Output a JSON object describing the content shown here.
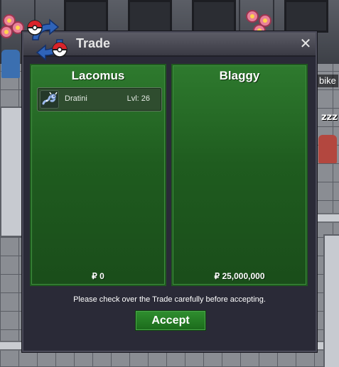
{
  "window": {
    "title": "Trade",
    "close_symbol": "✕",
    "close_icon": "close-icon",
    "logo_icon": "trade-arrows-icon"
  },
  "left_trader": {
    "name": "Lacomus",
    "offer": [
      {
        "pokemon": "Dratini",
        "level": "Lvl: 26",
        "icon": "dratini-icon"
      }
    ],
    "money": "₽ 0"
  },
  "right_trader": {
    "name": "Blaggy",
    "offer": [],
    "money": "₽ 25,000,000"
  },
  "notice": "Please check over the Trade carefully before accepting.",
  "accept_label": "Accept",
  "background": {
    "npc_name": "bike",
    "sleep_text": "zzz"
  },
  "colors": {
    "panel_green": "#2e7a2e",
    "window_bg": "#2a2a37",
    "button_green": "#1f7a1f"
  }
}
